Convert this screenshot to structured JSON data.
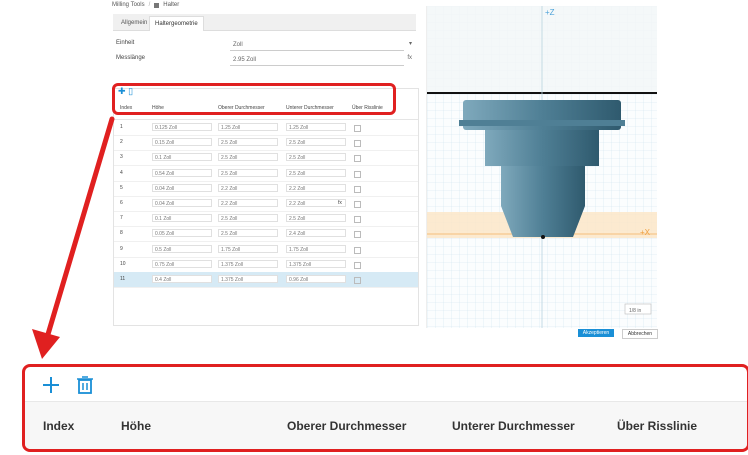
{
  "breadcrumb": {
    "items": [
      "Milling Tools",
      "Halter"
    ]
  },
  "tabs": [
    {
      "label": "Allgemein"
    },
    {
      "label": "Haltergeometrie"
    }
  ],
  "form": {
    "einheit_label": "Einheit",
    "einheit_value": "Zoll",
    "messlaenge_label": "Messlänge",
    "messlaenge_value": "2.95 Zoll",
    "fx": "fx"
  },
  "table": {
    "headers": [
      "Index",
      "Höhe",
      "Oberer Durchmesser",
      "Unterer Durchmesser",
      "Über Risslinie"
    ],
    "rows": [
      {
        "index": "1",
        "hoehe": "0.125 Zoll",
        "oben": "1.25 Zoll",
        "unten": "1.25 Zoll"
      },
      {
        "index": "2",
        "hoehe": "0.15 Zoll",
        "oben": "2.5 Zoll",
        "unten": "2.5 Zoll"
      },
      {
        "index": "3",
        "hoehe": "0.1 Zoll",
        "oben": "2.5 Zoll",
        "unten": "2.5 Zoll"
      },
      {
        "index": "4",
        "hoehe": "0.54 Zoll",
        "oben": "2.5 Zoll",
        "unten": "2.5 Zoll"
      },
      {
        "index": "5",
        "hoehe": "0.04 Zoll",
        "oben": "2.2 Zoll",
        "unten": "2.2 Zoll"
      },
      {
        "index": "6",
        "hoehe": "0.04 Zoll",
        "oben": "2.2 Zoll",
        "unten": "2.2 Zoll"
      },
      {
        "index": "7",
        "hoehe": "0.1 Zoll",
        "oben": "2.5 Zoll",
        "unten": "2.5 Zoll"
      },
      {
        "index": "8",
        "hoehe": "0.05 Zoll",
        "oben": "2.5 Zoll",
        "unten": "2.4 Zoll"
      },
      {
        "index": "9",
        "hoehe": "0.5 Zoll",
        "oben": "1.75 Zoll",
        "unten": "1.75 Zoll"
      },
      {
        "index": "10",
        "hoehe": "0.75 Zoll",
        "oben": "1.375 Zoll",
        "unten": "1.375 Zoll"
      },
      {
        "index": "11",
        "hoehe": "0.4 Zoll",
        "oben": "1.375 Zoll",
        "unten": "0.96 Zoll"
      }
    ]
  },
  "viewport": {
    "axis_z": "+Z",
    "axis_x": "+X",
    "scale": "1/8 in"
  },
  "buttons": {
    "accept": "Akzeptieren",
    "cancel": "Abbrechen"
  },
  "icons": {
    "add": "plus-icon",
    "delete": "trash-icon"
  },
  "colors": {
    "accent": "#1a8fd6",
    "callout": "#e02020",
    "holder": "#5b8da5"
  }
}
